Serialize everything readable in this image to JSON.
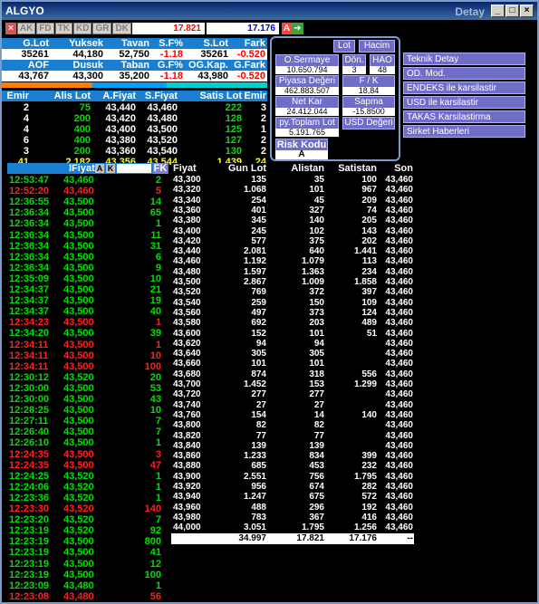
{
  "title": "ALGYO",
  "detay": "Detay",
  "tb_buttons": [
    "AK",
    "FD",
    "TK",
    "KD",
    "GR",
    "DK"
  ],
  "tb_price1": "17.821",
  "tb_price2": "17.176",
  "tb_a": "A",
  "summary": {
    "h1": [
      "G.Lot",
      "Yuksek",
      "Tavan",
      "S.F%",
      "S.Lot",
      "Fark"
    ],
    "v1": [
      "35261",
      "44,180",
      "52,750",
      "-1.18",
      "35261",
      "-0.520"
    ],
    "h2": [
      "AOF",
      "Dusuk",
      "Taban",
      "G.F%",
      "OG.Kap.",
      "G.Fark"
    ],
    "v2": [
      "43,767",
      "43,300",
      "35,200",
      "-1.18",
      "43,980",
      "-0.520"
    ]
  },
  "depth": {
    "headers": [
      "Emir",
      "Alis Lot",
      "A.Fiyat",
      "S.Fiyat",
      "Satis Lot",
      "Emir"
    ],
    "rows": [
      [
        "2",
        "75",
        "43,440",
        "43,460",
        "222",
        "3"
      ],
      [
        "4",
        "200",
        "43,420",
        "43,480",
        "128",
        "2"
      ],
      [
        "4",
        "400",
        "43,400",
        "43,500",
        "125",
        "1"
      ],
      [
        "6",
        "400",
        "43,380",
        "43,520",
        "127",
        "2"
      ],
      [
        "3",
        "200",
        "43,360",
        "43,540",
        "130",
        "2"
      ]
    ],
    "total": [
      "41",
      "2.182",
      "43,356",
      "43,544",
      "1.439",
      "24"
    ]
  },
  "panel": {
    "lot": "Lot",
    "hacim": "Hacim",
    "o_sermaye": "O.Sermaye",
    "o_sermaye_v": "10.650.794",
    "don": "Dön.",
    "don_v": "3",
    "hao": "HAO",
    "hao_v": "48",
    "piyasa": "Piyasa Değeri",
    "piyasa_v": "462.883.507",
    "fk": "F / K",
    "fk_v": "18,84",
    "netkar": "Net Kar",
    "netkar_v": "24.412.044",
    "sapma": "Sapma",
    "sapma_v": "-15.8500",
    "pytoplam": "py.Toplam Lot",
    "pytoplam_v": "5.191.765",
    "usd": "USD Değeri",
    "risk": "Risk Kodu",
    "risk_v": "A"
  },
  "menu": [
    "Teknik Detay",
    "OD. Mod.",
    "ENDEKS ile karsilastir",
    "USD ile karsilastir",
    "TAKAS Karsilastirma",
    "Sirket Haberleri"
  ],
  "trades_header": {
    "fiyat": "IFiyat",
    "a": "A",
    "k": "K",
    "fk": "FK"
  },
  "trades": [
    [
      "12:53:47",
      "43,460",
      "2",
      "g"
    ],
    [
      "12:52:20",
      "43,460",
      "5",
      "r"
    ],
    [
      "12:36:55",
      "43,500",
      "14",
      "g"
    ],
    [
      "12:36:34",
      "43,500",
      "65",
      "g"
    ],
    [
      "12:36:34",
      "43,500",
      "1",
      "g"
    ],
    [
      "12:36:34",
      "43,500",
      "11",
      "g"
    ],
    [
      "12:36:34",
      "43,500",
      "31",
      "g"
    ],
    [
      "12:36:34",
      "43,500",
      "6",
      "g"
    ],
    [
      "12:36:34",
      "43,500",
      "9",
      "g"
    ],
    [
      "12:35:09",
      "43,500",
      "10",
      "g"
    ],
    [
      "12:34:37",
      "43,500",
      "21",
      "g"
    ],
    [
      "12:34:37",
      "43,500",
      "19",
      "g"
    ],
    [
      "12:34:37",
      "43,500",
      "40",
      "g"
    ],
    [
      "12:34:23",
      "43,500",
      "1",
      "r"
    ],
    [
      "12:34:20",
      "43,500",
      "39",
      "g"
    ],
    [
      "12:34:11",
      "43,500",
      "1",
      "r"
    ],
    [
      "12:34:11",
      "43,500",
      "10",
      "r"
    ],
    [
      "12:34:11",
      "43,500",
      "100",
      "r"
    ],
    [
      "12:30:12",
      "43,520",
      "20",
      "g"
    ],
    [
      "12:30:00",
      "43,500",
      "53",
      "g"
    ],
    [
      "12:30:00",
      "43,500",
      "43",
      "g"
    ],
    [
      "12:28:25",
      "43,500",
      "10",
      "g"
    ],
    [
      "12:27:11",
      "43,500",
      "7",
      "g"
    ],
    [
      "12:26:40",
      "43,500",
      "7",
      "g"
    ],
    [
      "12:26:10",
      "43,500",
      "1",
      "g"
    ],
    [
      "12:24:35",
      "43,500",
      "3",
      "r"
    ],
    [
      "12:24:35",
      "43,500",
      "47",
      "r"
    ],
    [
      "12:24:25",
      "43,520",
      "1",
      "g"
    ],
    [
      "12:24:06",
      "43,520",
      "1",
      "g"
    ],
    [
      "12:23:36",
      "43,520",
      "1",
      "g"
    ],
    [
      "12:23:30",
      "43,520",
      "140",
      "r"
    ],
    [
      "12:23:20",
      "43,520",
      "7",
      "g"
    ],
    [
      "12:23:19",
      "43,520",
      "92",
      "g"
    ],
    [
      "12:23:19",
      "43,500",
      "800",
      "g"
    ],
    [
      "12:23:19",
      "43,500",
      "41",
      "g"
    ],
    [
      "12:23:19",
      "43,500",
      "12",
      "g"
    ],
    [
      "12:23:19",
      "43,500",
      "100",
      "g"
    ],
    [
      "12:23:09",
      "43,480",
      "1",
      "g"
    ],
    [
      "12:23:08",
      "43,480",
      "56",
      "r"
    ]
  ],
  "dist_headers": [
    "Fiyat",
    "Gun Lot",
    "Alistan",
    "Satistan",
    "Son"
  ],
  "dist": [
    [
      "43,300",
      "135",
      "35",
      "100",
      "43,460"
    ],
    [
      "43,320",
      "1.068",
      "101",
      "967",
      "43,460"
    ],
    [
      "43,340",
      "254",
      "45",
      "209",
      "43,460"
    ],
    [
      "43,360",
      "401",
      "327",
      "74",
      "43,460"
    ],
    [
      "43,380",
      "345",
      "140",
      "205",
      "43,460"
    ],
    [
      "43,400",
      "245",
      "102",
      "143",
      "43,460"
    ],
    [
      "43,420",
      "577",
      "375",
      "202",
      "43,460"
    ],
    [
      "43,440",
      "2.081",
      "640",
      "1.441",
      "43,460"
    ],
    [
      "43,460",
      "1.192",
      "1.079",
      "113",
      "43,460"
    ],
    [
      "43,480",
      "1.597",
      "1.363",
      "234",
      "43,460"
    ],
    [
      "43,500",
      "2.867",
      "1.009",
      "1.858",
      "43,460"
    ],
    [
      "43,520",
      "769",
      "372",
      "397",
      "43,460"
    ],
    [
      "43,540",
      "259",
      "150",
      "109",
      "43,460"
    ],
    [
      "43,560",
      "497",
      "373",
      "124",
      "43,460"
    ],
    [
      "43,580",
      "692",
      "203",
      "489",
      "43,460"
    ],
    [
      "43,600",
      "152",
      "101",
      "51",
      "43,460"
    ],
    [
      "43,620",
      "94",
      "94",
      "",
      "43,460"
    ],
    [
      "43,640",
      "305",
      "305",
      "",
      "43,460"
    ],
    [
      "43,660",
      "101",
      "101",
      "",
      "43,460"
    ],
    [
      "43,680",
      "874",
      "318",
      "556",
      "43,460"
    ],
    [
      "43,700",
      "1.452",
      "153",
      "1.299",
      "43,460"
    ],
    [
      "43,720",
      "277",
      "277",
      "",
      "43,460"
    ],
    [
      "43,740",
      "27",
      "27",
      "",
      "43,460"
    ],
    [
      "43,760",
      "154",
      "14",
      "140",
      "43,460"
    ],
    [
      "43,800",
      "82",
      "82",
      "",
      "43,460"
    ],
    [
      "43,820",
      "77",
      "77",
      "",
      "43,460"
    ],
    [
      "43,840",
      "139",
      "139",
      "",
      "43,460"
    ],
    [
      "43,860",
      "1.233",
      "834",
      "399",
      "43,460"
    ],
    [
      "43,880",
      "685",
      "453",
      "232",
      "43,460"
    ],
    [
      "43,900",
      "2.551",
      "756",
      "1.795",
      "43,460"
    ],
    [
      "43,920",
      "956",
      "674",
      "282",
      "43,460"
    ],
    [
      "43,940",
      "1.247",
      "675",
      "572",
      "43,460"
    ],
    [
      "43,960",
      "488",
      "296",
      "192",
      "43,460"
    ],
    [
      "43,980",
      "783",
      "367",
      "416",
      "43,460"
    ],
    [
      "44,000",
      "3.051",
      "1.795",
      "1.256",
      "43,460"
    ]
  ],
  "dist_total": [
    "34.997",
    "17.821",
    "17.176",
    "--"
  ],
  "colors": {
    "green": "#00e000",
    "red": "#ff2020",
    "yellow": "#ffff00",
    "header_blue": "#1a7fd0"
  }
}
